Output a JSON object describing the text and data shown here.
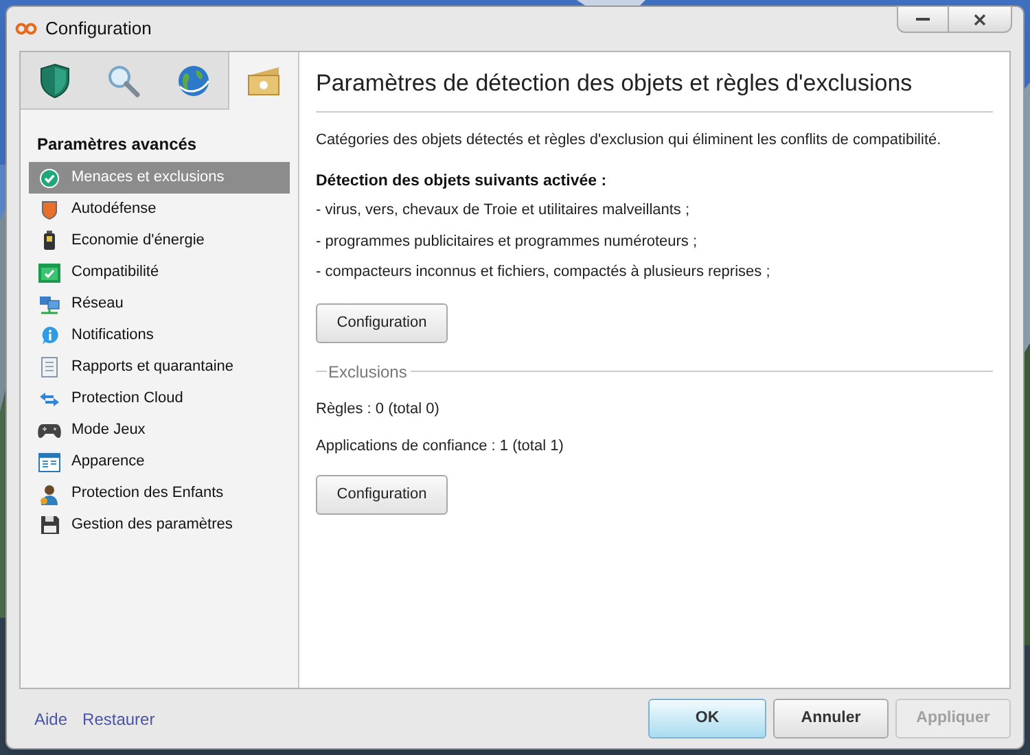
{
  "window": {
    "title": "Configuration"
  },
  "tabs": [
    {
      "kind": "shield",
      "selected": false
    },
    {
      "kind": "search",
      "selected": false
    },
    {
      "kind": "globe",
      "selected": false
    },
    {
      "kind": "box",
      "selected": true
    }
  ],
  "sidebar": {
    "heading": "Paramètres avancés",
    "items": [
      {
        "kind": "check",
        "label": "Menaces et exclusions",
        "selected": true
      },
      {
        "kind": "shield",
        "label": "Autodéfense",
        "selected": false
      },
      {
        "kind": "battery",
        "label": "Economie d'énergie",
        "selected": false
      },
      {
        "kind": "window-check",
        "label": "Compatibilité",
        "selected": false
      },
      {
        "kind": "network",
        "label": "Réseau",
        "selected": false
      },
      {
        "kind": "info",
        "label": "Notifications",
        "selected": false
      },
      {
        "kind": "report",
        "label": "Rapports et quarantaine",
        "selected": false
      },
      {
        "kind": "arrows",
        "label": "Protection Cloud",
        "selected": false
      },
      {
        "kind": "gamepad",
        "label": "Mode Jeux",
        "selected": false
      },
      {
        "kind": "appearance",
        "label": "Apparence",
        "selected": false
      },
      {
        "kind": "person",
        "label": "Protection des Enfants",
        "selected": false
      },
      {
        "kind": "disk",
        "label": "Gestion des paramètres",
        "selected": false
      }
    ]
  },
  "content": {
    "title": "Paramètres de détection des objets et règles d'exclusions",
    "description": "Catégories des objets détectés et règles d'exclusion qui éliminent les conflits de compatibilité.",
    "detection_heading": "Détection des objets suivants activée :",
    "detection_items": [
      "- virus, vers, chevaux de Troie et utilitaires malveillants ;",
      "- programmes publicitaires et programmes numéroteurs ;",
      "- compacteurs inconnus et fichiers, compactés à plusieurs reprises ;"
    ],
    "detection_button": "Configuration",
    "exclusions_legend": "Exclusions",
    "exclusions_lines": [
      "Règles : 0 (total 0)",
      "Applications de confiance : 1 (total 1)"
    ],
    "exclusions_button": "Configuration"
  },
  "footer": {
    "links": [
      "Aide",
      "Restaurer"
    ],
    "buttons": [
      {
        "label": "OK",
        "default": true,
        "disabled": false
      },
      {
        "label": "Annuler",
        "default": false,
        "disabled": false
      },
      {
        "label": "Appliquer",
        "default": false,
        "disabled": true
      }
    ]
  }
}
